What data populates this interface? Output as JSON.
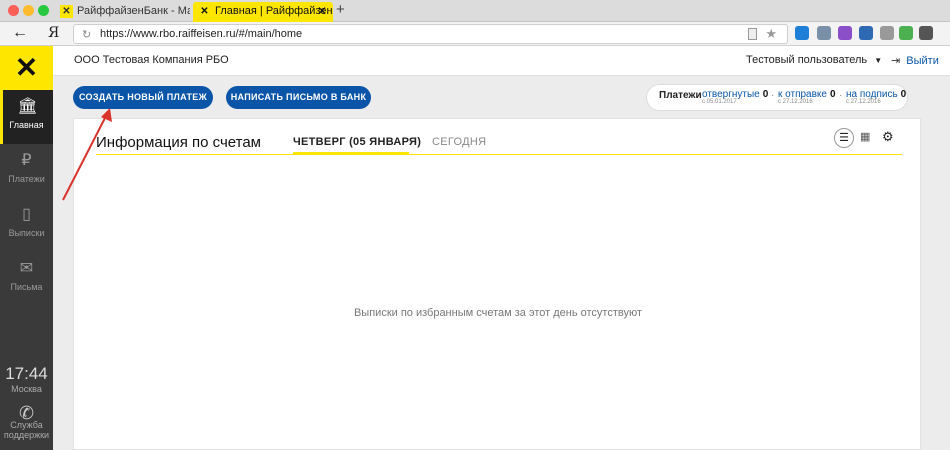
{
  "browser": {
    "tabs": [
      {
        "label": "РайффайзенБанк - Малом",
        "active": false
      },
      {
        "label": "Главная | Райффайзенб",
        "active": true
      }
    ],
    "new_tab": "+",
    "back": "←",
    "ya": "Я",
    "url": "https://www.rbo.raiffeisen.ru/#/main/home"
  },
  "sidebar": {
    "items": [
      {
        "label": "Главная",
        "icon": "bank-icon"
      },
      {
        "label": "Платежи",
        "icon": "payments-icon"
      },
      {
        "label": "Выписки",
        "icon": "statements-icon"
      },
      {
        "label": "Письма",
        "icon": "mail-icon"
      }
    ],
    "clock": {
      "time": "17:44",
      "city": "Москва"
    },
    "support": "Служба поддержки"
  },
  "header": {
    "company": "ООО Тестовая Компания РБО",
    "user": "Тестовый пользователь",
    "exit": "Выйти"
  },
  "actions": {
    "new_payment": "СОЗДАТЬ НОВЫЙ ПЛАТЕЖ",
    "write_letter": "НАПИСАТЬ ПИСЬМО В БАНК"
  },
  "payments": {
    "label": "Платежи",
    "items": [
      {
        "label": "отвергнутые",
        "count": "0",
        "date": "с 05.01.2017"
      },
      {
        "label": "к отправке",
        "count": "0",
        "date": "с 27.12.2016"
      },
      {
        "label": "на подпись",
        "count": "0",
        "date": "с 27.12.2016"
      }
    ]
  },
  "main": {
    "title": "Информация по счетам",
    "tab_day": "ЧЕТВЕРГ (05 ЯНВАРЯ)",
    "tab_today": "СЕГОДНЯ",
    "empty": "Выписки по избранным счетам за этот день отсутствуют"
  },
  "colors": {
    "brand": "#fee600",
    "accent": "#0a55a8",
    "sidebar": "#3a3a3a"
  }
}
